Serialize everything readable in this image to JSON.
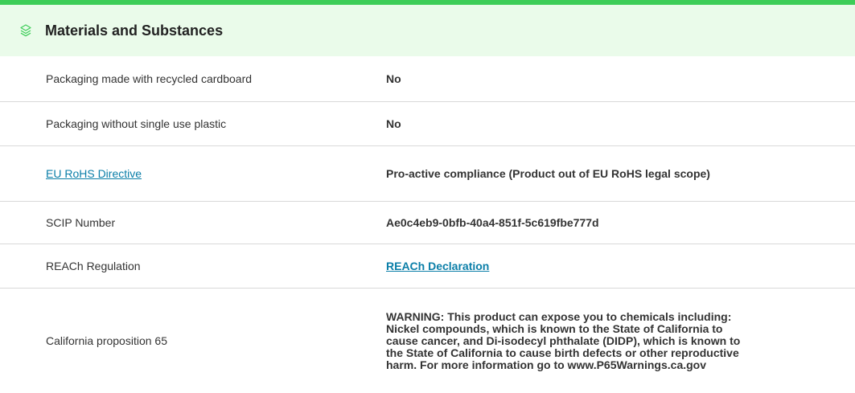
{
  "section": {
    "title": "Materials and Substances",
    "icon": "layers-icon",
    "accent_color": "#3dcd58",
    "header_bg": "#eafbea",
    "link_color": "#0a7ea8"
  },
  "rows": [
    {
      "label": "Packaging made with recycled cardboard",
      "value": "No"
    },
    {
      "label": "Packaging without single use plastic",
      "value": "No"
    },
    {
      "label": "EU RoHS Directive",
      "value": "Pro-active compliance (Product out of EU RoHS legal scope)"
    },
    {
      "label": "SCIP Number",
      "value": "Ae0c4eb9-0bfb-40a4-851f-5c619fbe777d"
    },
    {
      "label": "REACh Regulation",
      "value": "REACh Declaration"
    },
    {
      "label": "California proposition 65",
      "value": "WARNING: This product can expose you to chemicals including: Nickel compounds, which is known to the State of California to cause cancer, and Di-isodecyl phthalate (DIDP), which is known to the State of California to cause birth defects or other reproductive harm. For more information go to www.P65Warnings.ca.gov"
    }
  ]
}
